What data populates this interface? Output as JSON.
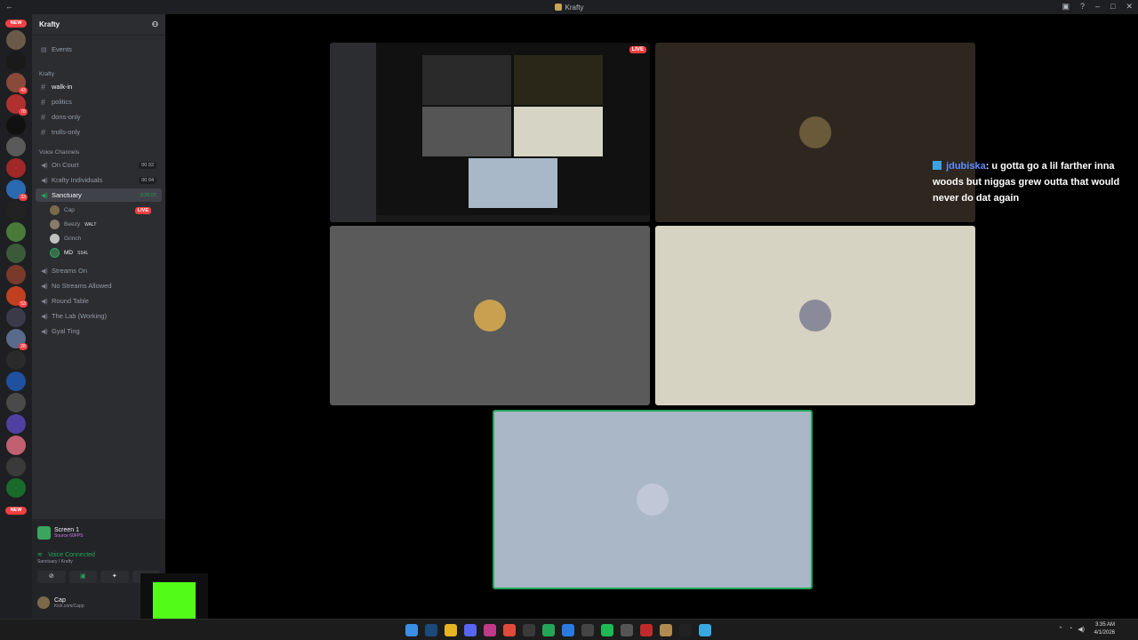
{
  "window": {
    "title": "Krafty"
  },
  "servers": {
    "new_label": "NEW",
    "badges": [
      "43",
      "78",
      "33",
      "53",
      "28"
    ]
  },
  "guild": {
    "name": "Krafty"
  },
  "sidebar": {
    "events_label": "Events",
    "text_category": "Krafty",
    "channels": [
      "walk-in",
      "politics",
      "dons-only",
      "trolls-only"
    ],
    "voice_category": "Voice Channels",
    "voice_top": [
      {
        "label": "On Court",
        "count": "00 02"
      },
      {
        "label": "Krafty Individuals",
        "count": "00 04"
      }
    ],
    "sanctuary": {
      "label": "Sanctuary",
      "timer": "3:26:07"
    },
    "users": [
      {
        "name": "Cap",
        "tag": "",
        "live": "LIVE"
      },
      {
        "name": "Beezy",
        "tag": "WALT",
        "live": ""
      },
      {
        "name": "Grinch",
        "tag": "",
        "live": ""
      },
      {
        "name": "MD",
        "tag": "SS4L",
        "live": ""
      }
    ],
    "voice_bottom": [
      "Streams On",
      "No Streams Allowed",
      "Round Table",
      "The Lab (Working)",
      "Gyal Ting"
    ]
  },
  "panel": {
    "screen_label": "Screen 1",
    "screen_sub": "Source 60FPS",
    "voice_status": "Voice Connected",
    "voice_location": "Sanctuary / Krafty",
    "user_name": "Cap",
    "user_status": "Kick.com/Capp"
  },
  "stage": {
    "live_label": "LIVE"
  },
  "chat": {
    "username": "jdubiska",
    "message": ": u gotta go a lil farther inna woods but niggas grew outta that would never do dat again"
  },
  "taskbar": {
    "time": "3:35 AM",
    "date": "4/1/2026"
  },
  "colors": {
    "accent_green": "#23a55a",
    "live_red": "#f23f42",
    "kick_green": "#53fc18"
  }
}
